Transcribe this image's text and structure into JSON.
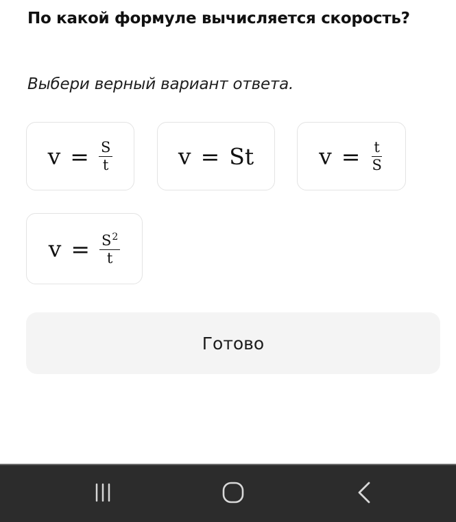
{
  "question": {
    "title": "По какой формуле вычисляется скорость?",
    "instruction": "Выбери верный вариант ответа."
  },
  "options": [
    {
      "lhs": "v",
      "eq": "=",
      "numerator": "S",
      "denominator": "t"
    },
    {
      "lhs": "v",
      "eq": "=",
      "rhs": "St"
    },
    {
      "lhs": "v",
      "eq": "=",
      "numerator": "t",
      "denominator": "S"
    },
    {
      "lhs": "v",
      "eq": "=",
      "numerator": "S",
      "numerator_exponent": "2",
      "denominator": "t"
    }
  ],
  "done_button": {
    "label": "Готово"
  },
  "navbar": {
    "icons": [
      "recent-apps-icon",
      "home-icon",
      "back-icon"
    ],
    "background": "#2c2c2c"
  },
  "colors": {
    "option_border": "#e3e3e3",
    "button_background": "#f4f4f4"
  }
}
